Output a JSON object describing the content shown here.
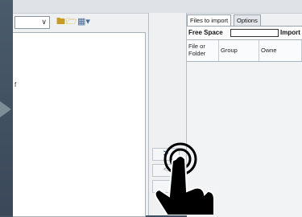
{
  "explorer": {
    "path_value": "",
    "list_fragment": "f"
  },
  "transfer": {
    "add_label": ">",
    "remove_label": "<"
  },
  "import_panel": {
    "tabs": [
      {
        "label": "Files to import",
        "active": true
      },
      {
        "label": "Options",
        "active": false
      }
    ],
    "free_space_label": "Free Space",
    "import_label": "Import",
    "columns": [
      "File or Folder",
      "Group",
      "Owne"
    ]
  },
  "icons": {
    "combo": "chevron-down-icon",
    "up_folder": "folder-up-icon",
    "new_folder": "new-folder-icon",
    "view_mode": "view-mode-icon",
    "play": "play-icon",
    "hand": "pointing-hand-icon"
  },
  "colors": {
    "accent": "#1d5fb8",
    "disabled": "#9aa3ab"
  }
}
